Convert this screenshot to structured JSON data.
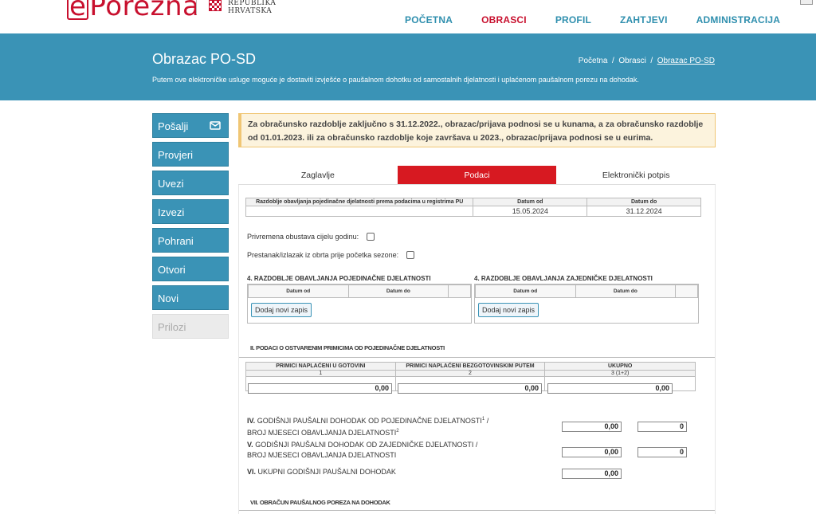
{
  "header": {
    "logo_e": "e",
    "logo_rest": "Porezna",
    "republic_line1": "REPUBLIKA",
    "republic_line2": "HRVATSKA",
    "nav": [
      "POČETNA",
      "OBRASCI",
      "PROFIL",
      "ZAHTJEVI",
      "ADMINISTRACIJA"
    ],
    "nav_active": 1
  },
  "banner": {
    "title": "Obrazac PO-SD",
    "subtitle": "Putem ove elektroničke usluge moguće je dostaviti izvješće o paušalnom dohotku od samostalnih djelatnosti i uplaćenom paušalnom porezu na dohodak.",
    "breadcrumb": [
      "Početna",
      "Obrasci",
      "Obrazac PO-SD"
    ],
    "breadcrumb_sep": "/"
  },
  "sidebar": {
    "items": [
      "Pošalji",
      "Provjeri",
      "Uvezi",
      "Izvezi",
      "Pohrani",
      "Otvori",
      "Novi",
      "Prilozi"
    ],
    "send_icon": "envelope-send-icon"
  },
  "notice": {
    "text": "Za obračunsko razdoblje zaključno s 31.12.2022., obrazac/prijava podnosi se u kunama, a za obračunsko razdoblje od 01.01.2023. ili za obračunsko razdoblje koje završava u 2023., obrazac/prijava podnosi se u eurima."
  },
  "tabs": [
    "Zaglavlje",
    "Podaci",
    "Elektronički potpis"
  ],
  "period_table": {
    "col1": "Razdoblje obavljanja pojedinačne djelatnosti prema podacima u registrima PU",
    "col2": "Datum od",
    "col3": "Datum do",
    "val_from": "15.05.2024",
    "val_to": "31.12.2024"
  },
  "checks": {
    "suspension": "Privremena obustava cijelu godinu:",
    "termination": "Prestanak/izlazak iz obrta prije početka sezone:"
  },
  "individual": {
    "title": "4. RAZDOBLJE OBAVLJANJA POJEDINAČNE DJELATNOSTI",
    "from": "Datum od",
    "to": "Datum do",
    "add": "Dodaj novi zapis"
  },
  "joint": {
    "title": "4. RAZDOBLJE OBAVLJANJA ZAJEDNIČKE DJELATNOSTI",
    "from": "Datum od",
    "to": "Datum do",
    "add": "Dodaj novi zapis"
  },
  "section2": {
    "title": "II. PODACI O OSTVARENIM PRIMICIMA OD POJEDINAČNE DJELATNOSTI",
    "cols": [
      "PRIMICI NAPLAĆENI U GOTOVINI",
      "PRIMICI NAPLAĆENI BEZGOTOVINSKIM PUTEM",
      "UKUPNO"
    ],
    "nums": [
      "1",
      "2",
      "3 (1+2)"
    ],
    "values": [
      "0,00",
      "0,00",
      "0,00"
    ]
  },
  "rows": {
    "iv_num": "IV.",
    "iv_text": "GODIŠNJI PAUŠALNI DOHODAK OD POJEDINAČNE DJELATNOSTI",
    "iv_sup1": "1",
    "iv_mid": " / ",
    "iv_text2": "BROJ MJESECI OBAVLJANJA DJELATNOSTI",
    "iv_sup2": "2",
    "iv_val": "0,00",
    "iv_months": "0",
    "v_num": "V.",
    "v_text": "GODIŠNJI PAUŠALNI DOHODAK OD ZAJEDNIČKE DJELATNOSTI /",
    "v_text2": "BROJ MJESECI OBAVLJANJA DJELATNOSTI",
    "v_val": "0,00",
    "v_months": "0",
    "vi_num": "VI.",
    "vi_text": "UKUPNI GODIŠNJI PAUŠALNI DOHODAK",
    "vi_val": "0,00"
  },
  "section7": {
    "title": "VII. OBRAČUN PAUŠALNOG POREZA NA DOHODAK"
  },
  "colors": {
    "brand_blue": "#3a93b6",
    "brand_red": "#c8102e",
    "tab_red": "#d71921",
    "notice_bg": "#fcf3dd"
  }
}
